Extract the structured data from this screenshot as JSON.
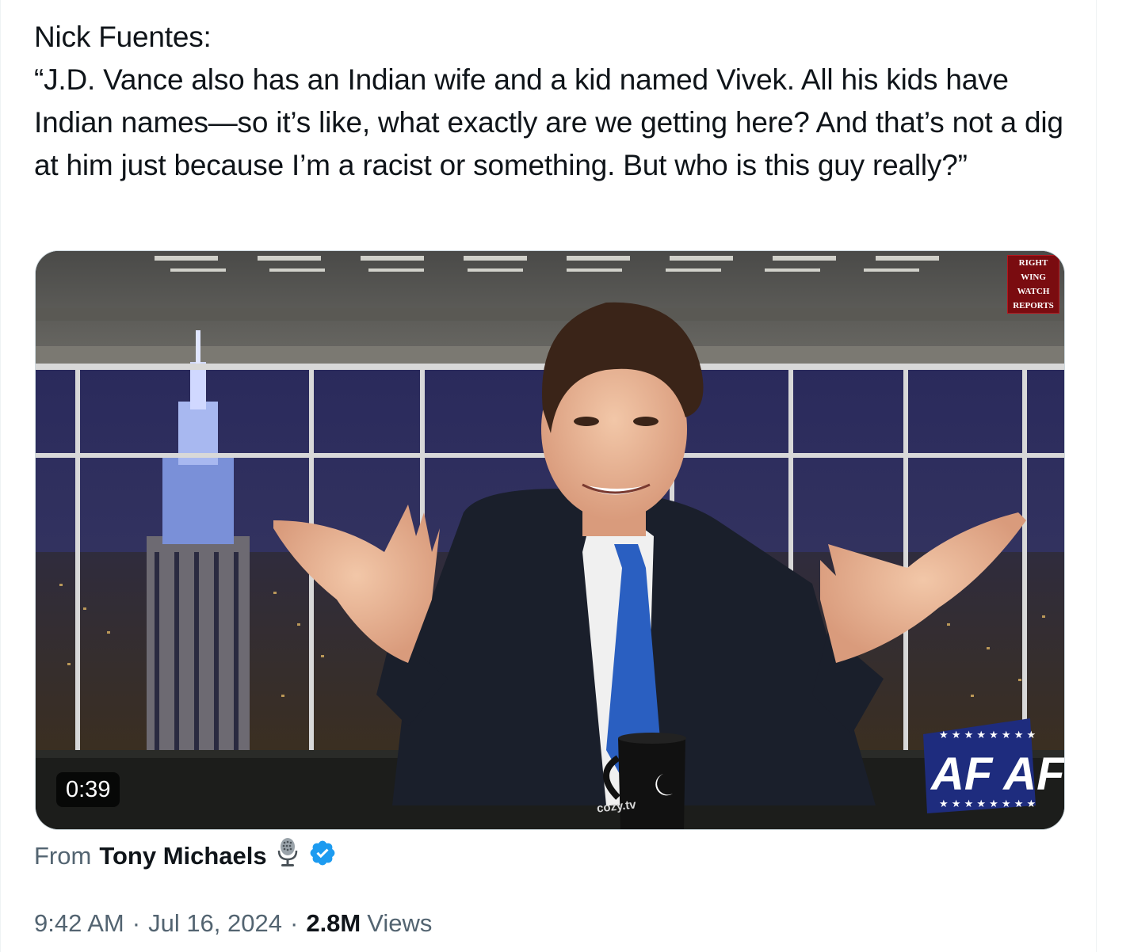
{
  "tweet": {
    "text": "Nick Fuentes:\n“J.D. Vance also has an Indian wife and a kid named Vivek. All his kids have Indian names—so it’s like, what exactly are we getting here? And that’s not a dig at him just because I’m a racist or something. But who is this guy really?”",
    "media": {
      "duration": "0:39",
      "watermark_lines": [
        "RIGHT",
        "WING",
        "WATCH",
        "REPORTS"
      ],
      "mug_text": "cozy.tv",
      "logo_text": "AF AF"
    },
    "source": {
      "from_label": "From",
      "author_name": "Tony Michaels",
      "icons": [
        "microphone-icon",
        "verified-badge-icon"
      ],
      "verified_color": "#1d9bf0"
    },
    "meta": {
      "time": "9:42 AM",
      "separator": "·",
      "date": "Jul 16, 2024",
      "views_count": "2.8M",
      "views_label": "Views"
    }
  }
}
